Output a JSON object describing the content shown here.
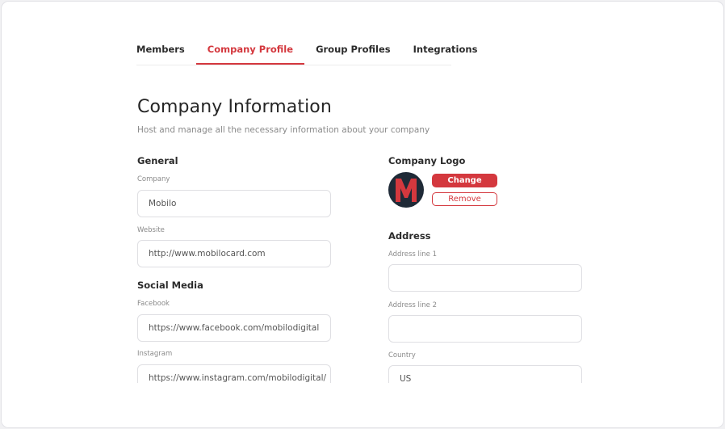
{
  "tabs": [
    {
      "label": "Members"
    },
    {
      "label": "Company Profile"
    },
    {
      "label": "Group Profiles"
    },
    {
      "label": "Integrations"
    }
  ],
  "page": {
    "title": "Company Information",
    "subtitle": "Host and manage all the necessary information about your company"
  },
  "general": {
    "heading": "General",
    "company_label": "Company",
    "company_value": "Mobilo",
    "website_label": "Website",
    "website_value": "http://www.mobilocard.com"
  },
  "social": {
    "heading": "Social Media",
    "facebook_label": "Facebook",
    "facebook_value": "https://www.facebook.com/mobilodigital",
    "instagram_label": "Instagram",
    "instagram_value": "https://www.instagram.com/mobilodigital/"
  },
  "logo": {
    "heading": "Company Logo",
    "letter": "M",
    "change_label": "Change",
    "remove_label": "Remove"
  },
  "address": {
    "heading": "Address",
    "line1_label": "Address line 1",
    "line1_value": "",
    "line2_label": "Address line 2",
    "line2_value": "",
    "country_label": "Country",
    "country_value": "US"
  },
  "colors": {
    "accent": "#d4383e",
    "logo_bg": "#1f2a37"
  }
}
